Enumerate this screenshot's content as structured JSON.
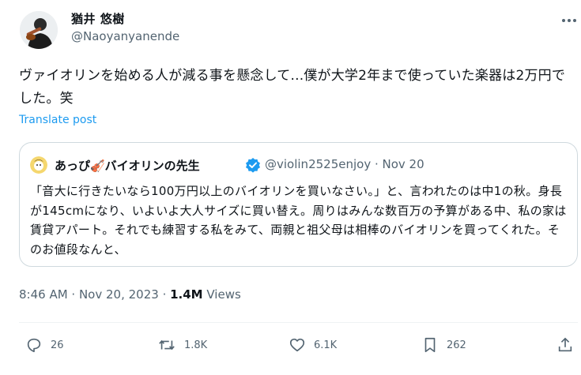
{
  "author": {
    "name": "猶井 悠樹",
    "handle": "@Naoyanyanende"
  },
  "tweet": {
    "text": "ヴァイオリンを始める人が減る事を懸念して...僕が大学2年まで使っていた楽器は2万円でした。笑",
    "translate_label": "Translate post"
  },
  "quote": {
    "name": "あっぴ🎻バイオリンの先生",
    "handle": "@violin2525enjoy · Nov 20",
    "text": "「音大に行きたいなら100万円以上のバイオリンを買いなさい。」と、言われたのは中1の秋。身長が145cmになり、いよいよ大人サイズに買い替え。周りはみんな数百万の予算がある中、私の家は賃貸アパート。それでも練習する私をみて、両親と祖父母は相棒のバイオリンを買ってくれた。そのお値段なんと、"
  },
  "meta": {
    "time": "8:46 AM · Nov 20, 2023 · ",
    "views_count": "1.4M",
    "views_label": " Views"
  },
  "actions": {
    "replies": "26",
    "reposts": "1.8K",
    "likes": "6.1K",
    "bookmarks": "262"
  },
  "colors": {
    "accent": "#1d9bf0",
    "secondary_text": "#536471",
    "border": "#cfd9de"
  }
}
